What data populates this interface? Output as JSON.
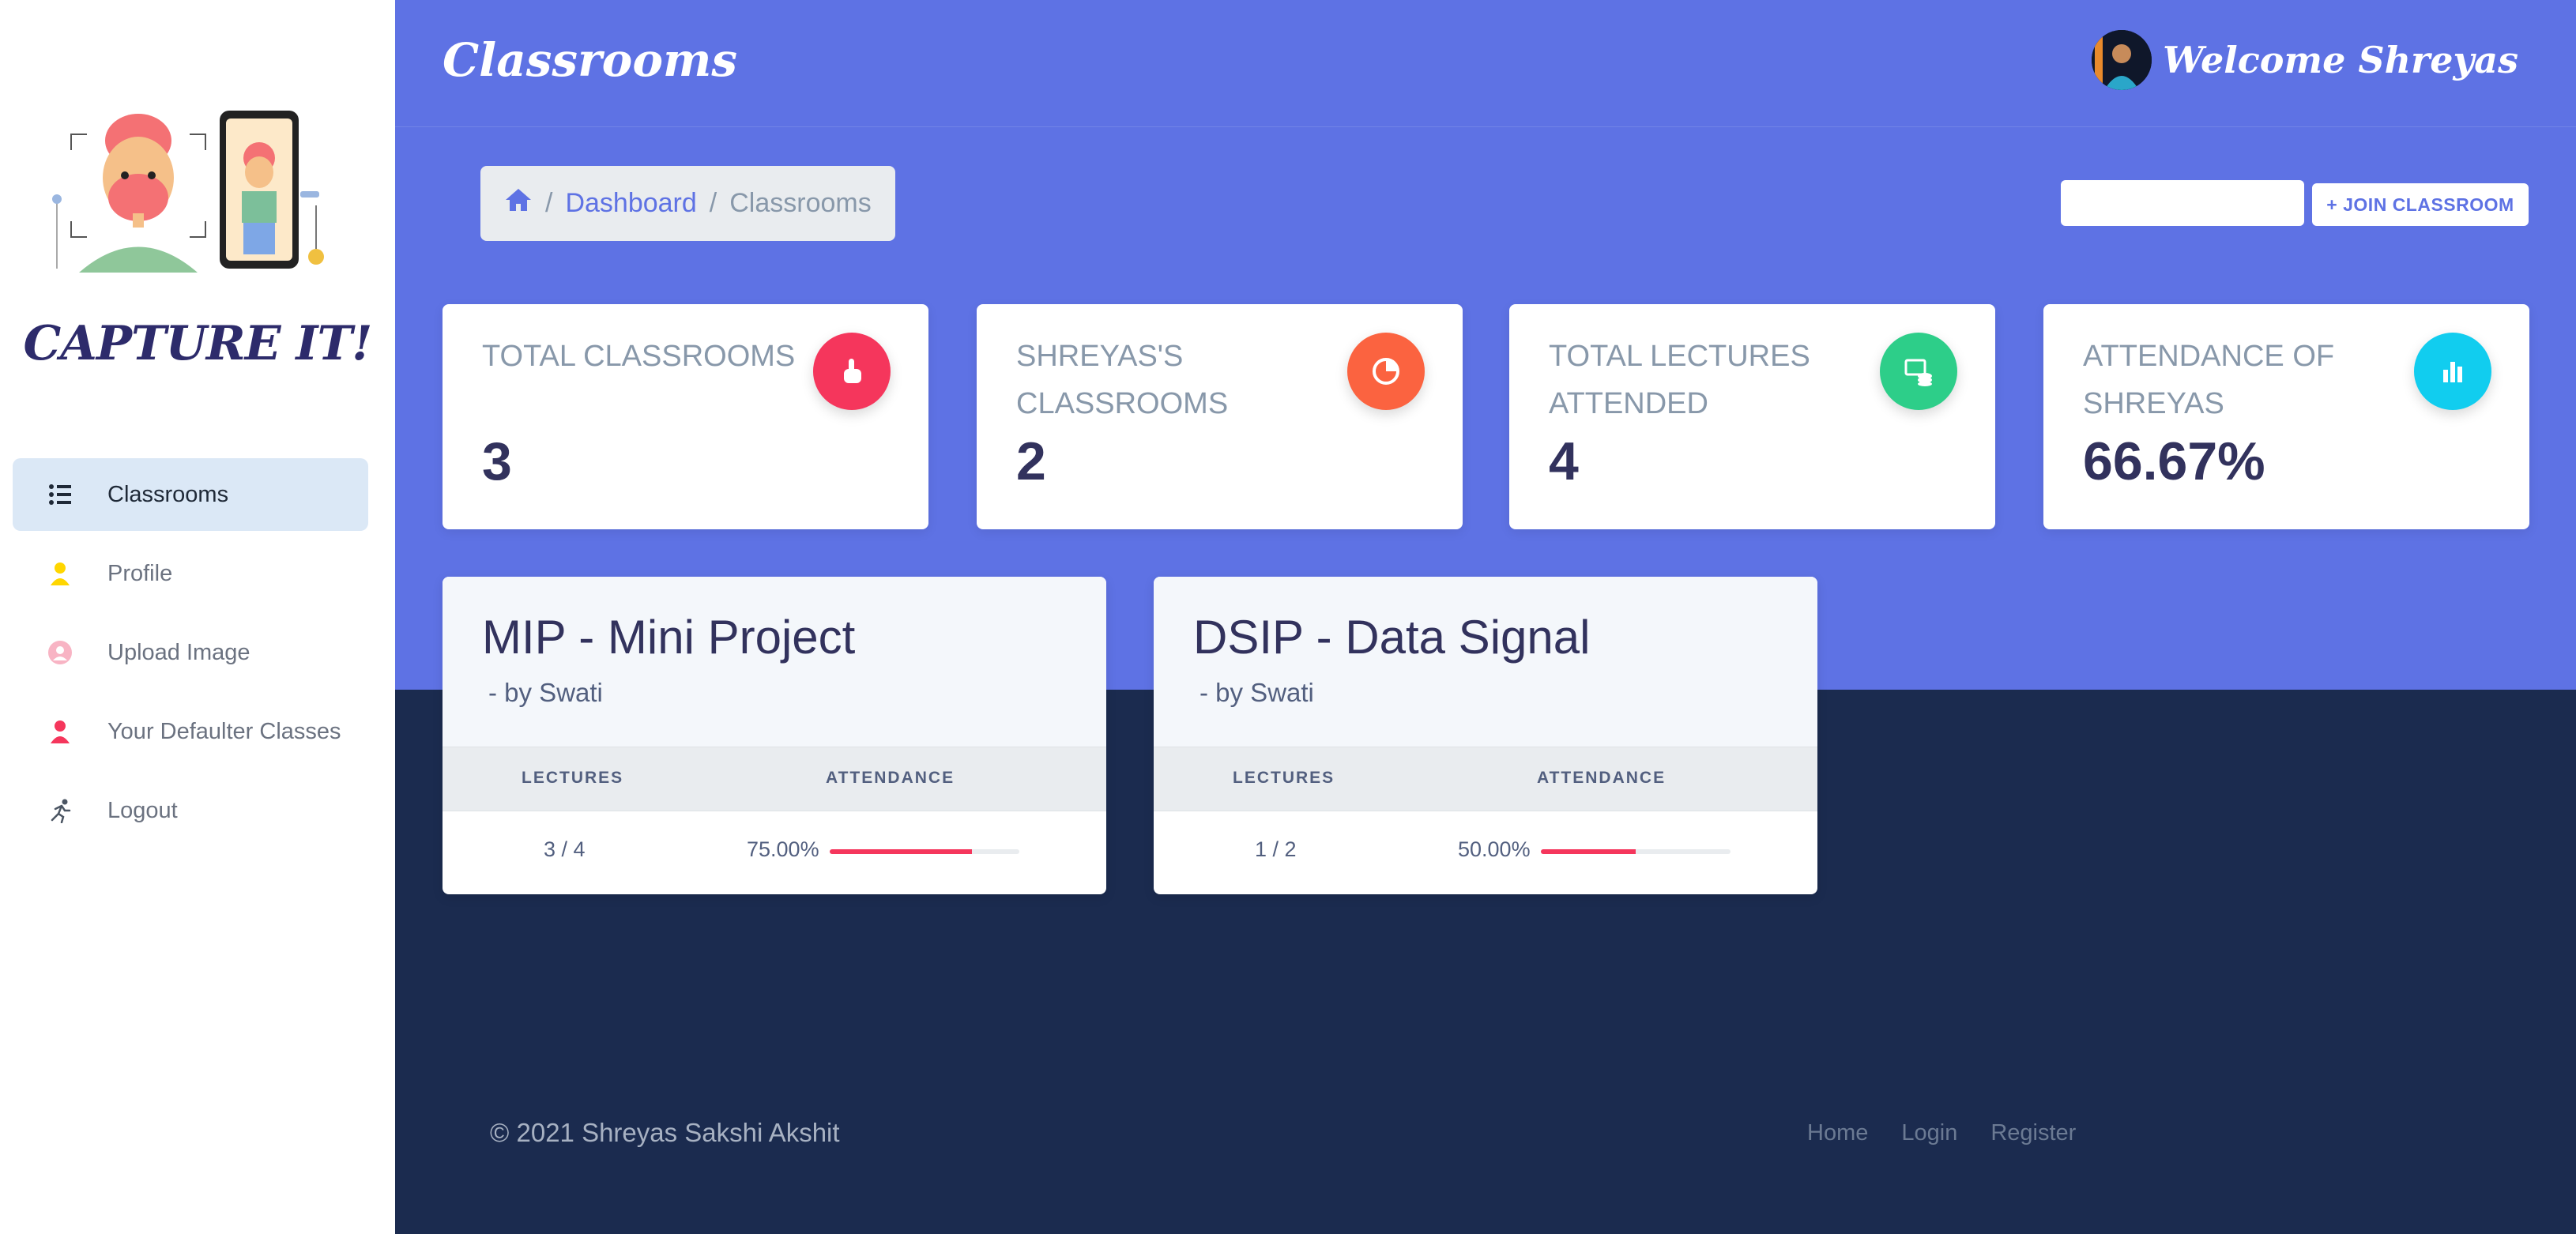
{
  "sidebar": {
    "brand": "CAPTURE IT!",
    "items": [
      {
        "label": "Classrooms",
        "icon": "list-icon"
      },
      {
        "label": "Profile",
        "icon": "user-icon"
      },
      {
        "label": "Upload Image",
        "icon": "user-circle-icon"
      },
      {
        "label": "Your Defaulter Classes",
        "icon": "user-icon"
      },
      {
        "label": "Logout",
        "icon": "running-icon"
      }
    ]
  },
  "header": {
    "title": "Classrooms",
    "welcome": "Welcome Shreyas"
  },
  "breadcrumb": {
    "home_icon": "home-icon",
    "dashboard": "Dashboard",
    "current": "Classrooms",
    "separator": "/"
  },
  "join": {
    "input_value": "",
    "button_label": "+ JOIN CLASSROOM"
  },
  "stats": [
    {
      "title": "TOTAL CLASSROOMS",
      "value": "3",
      "icon": "hand-pointer-icon",
      "color": "#f5365c"
    },
    {
      "title": "SHREYAS'S CLASSROOMS",
      "value": "2",
      "icon": "pie-chart-icon",
      "color": "#fb6340"
    },
    {
      "title": "TOTAL LECTURES ATTENDED",
      "value": "4",
      "icon": "money-coins-icon",
      "color": "#2dce89"
    },
    {
      "title": "ATTENDANCE OF SHREYAS",
      "value": "66.67%",
      "icon": "bar-chart-icon",
      "color": "#11cdef"
    }
  ],
  "classrooms": [
    {
      "title": "MIP - Mini Project",
      "by": "- by Swati",
      "col_lectures": "LECTURES",
      "col_attendance": "ATTENDANCE",
      "lectures": "3 / 4",
      "attendance": "75.00%",
      "attendance_fraction": 0.75
    },
    {
      "title": "DSIP - Data Signal",
      "by": "- by Swati",
      "col_lectures": "LECTURES",
      "col_attendance": "ATTENDANCE",
      "lectures": "1 / 2",
      "attendance": "50.00%",
      "attendance_fraction": 0.5
    }
  ],
  "footer": {
    "copyright": "© 2021 Shreyas Sakshi Akshit",
    "links": [
      "Home",
      "Login",
      "Register"
    ]
  },
  "colors": {
    "primary": "#5e72e4",
    "dark": "#1b2b4f",
    "danger": "#f5365c"
  }
}
